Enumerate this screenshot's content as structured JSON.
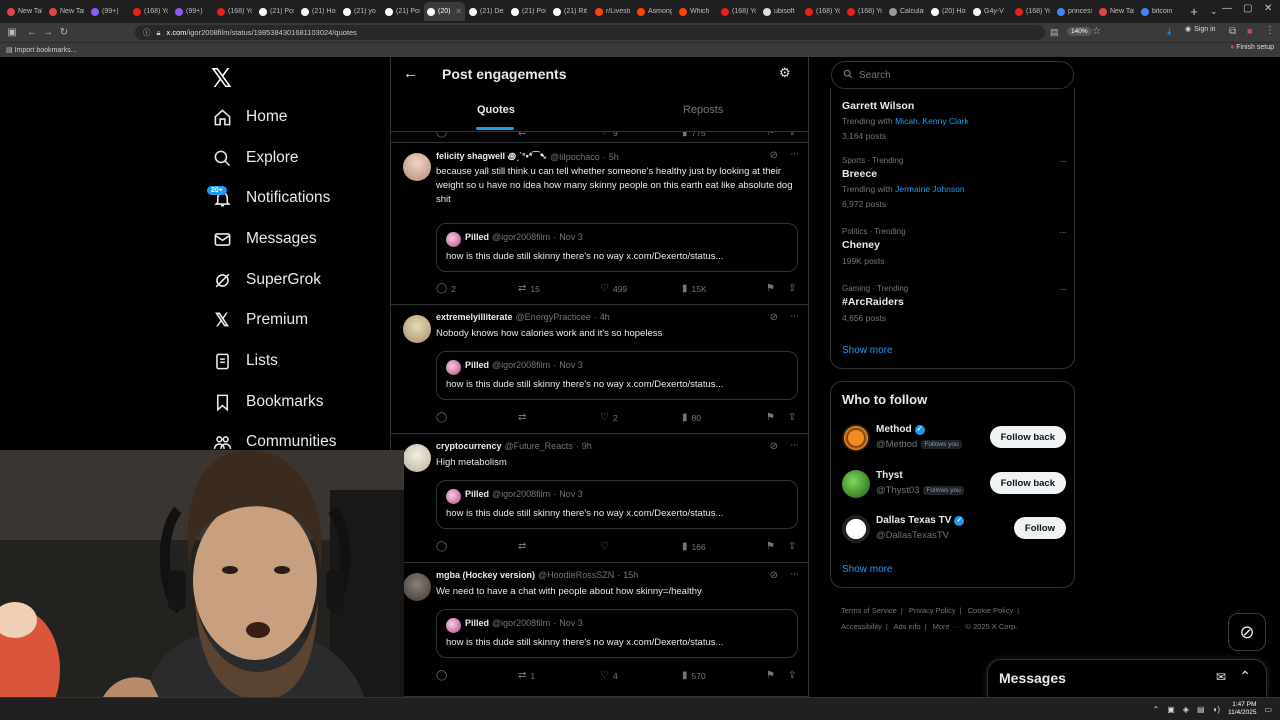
{
  "browser": {
    "tabs": [
      {
        "label": "New Tab",
        "color": "#e04545"
      },
      {
        "label": "New Tab",
        "color": "#e04545"
      },
      {
        "label": "(99+)",
        "color": "#8a5cf5"
      },
      {
        "label": "(168) YouTube",
        "color": "#e62117"
      },
      {
        "label": "(99+)",
        "color": "#8a5cf5"
      },
      {
        "label": "(168) YouTube",
        "color": "#e62117"
      },
      {
        "label": "(21) Post",
        "color": "#ffffff"
      },
      {
        "label": "(21) Home",
        "color": "#ffffff"
      },
      {
        "label": "(21) yo",
        "color": "#ffffff"
      },
      {
        "label": "(21) Post",
        "color": "#ffffff"
      },
      {
        "label": "(20)",
        "color": "#ffffff",
        "active": true
      },
      {
        "label": "(21) Dexerto",
        "color": "#ffffff"
      },
      {
        "label": "(21) Post",
        "color": "#ffffff"
      },
      {
        "label": "(21) Rit",
        "color": "#ffffff"
      },
      {
        "label": "r/Livestream",
        "color": "#ff4500"
      },
      {
        "label": "Asmongold",
        "color": "#ff4500"
      },
      {
        "label": "Which",
        "color": "#ff4500"
      },
      {
        "label": "(168) YouTube",
        "color": "#e62117"
      },
      {
        "label": "ubisoft",
        "color": "#dddddd"
      },
      {
        "label": "(168) YouTube",
        "color": "#e62117"
      },
      {
        "label": "(168) YouTube",
        "color": "#e62117"
      },
      {
        "label": "Calculator",
        "color": "#999999"
      },
      {
        "label": "(20) Home",
        "color": "#ffffff"
      },
      {
        "label": "G4y-V",
        "color": "#ffffff"
      },
      {
        "label": "(168) YouTube",
        "color": "#e62117"
      },
      {
        "label": "princess",
        "color": "#4285f4"
      },
      {
        "label": "New Tab",
        "color": "#e04545"
      },
      {
        "label": "bitcoin",
        "color": "#4285f4"
      }
    ],
    "url_host": "x.com",
    "url_path": "/igor2008film/status/1985384301681103024/quotes",
    "zoom": "140%",
    "signin": "Sign in",
    "import_bookmarks": "Import bookmarks...",
    "finish_setup": "Finish setup"
  },
  "nav": {
    "logo": "𝕏",
    "items": [
      {
        "label": "Home"
      },
      {
        "label": "Explore"
      },
      {
        "label": "Notifications"
      },
      {
        "label": "Messages"
      },
      {
        "label": "SuperGrok"
      },
      {
        "label": "Premium"
      },
      {
        "label": "Lists"
      },
      {
        "label": "Bookmarks"
      },
      {
        "label": "Communities"
      }
    ],
    "notif_count": "20+"
  },
  "header": {
    "back": "←",
    "title": "Post engagements",
    "tabs": [
      "Quotes",
      "Reposts"
    ]
  },
  "top_actions": {
    "likes": "9",
    "views": "775"
  },
  "quoted": {
    "name": "Pilled",
    "handle": "@igor2008film",
    "date": "Nov 3",
    "text": "how is this dude still skinny there's no way x.com/Dexerto/status..."
  },
  "tweets": [
    {
      "name": "felicity shagwell ꩜ˏˋ°•*⁀➷",
      "handle": "@liIpochaco",
      "time": "5h",
      "text": "because yall still think u can tell whether someone's healthy just by looking at their weight so u have no idea how many skinny people on this earth eat like absolute dog shit",
      "replies": "2",
      "reposts": "15",
      "likes": "499",
      "views": "15K"
    },
    {
      "name": "extremelyilliterate",
      "handle": "@EnergyPracticee",
      "time": "4h",
      "text": "Nobody knows how calories work and it's so hopeless",
      "replies": "",
      "reposts": "",
      "likes": "2",
      "views": "80"
    },
    {
      "name": "cryptocurrency",
      "handle": "@Future_Reacts",
      "time": "9h",
      "text": "High metabolism",
      "replies": "",
      "reposts": "",
      "likes": "",
      "views": "166"
    },
    {
      "name": "mgba (Hockey version)",
      "handle": "@HoodieRossSZN",
      "time": "15h",
      "text": "We need to have a chat with people about how skinny=/healthy",
      "replies": "",
      "reposts": "1",
      "likes": "4",
      "views": "570"
    }
  ],
  "search": {
    "placeholder": "Search"
  },
  "trends": [
    {
      "category": "",
      "title": "Garrett Wilson",
      "with_label": "Trending with",
      "with_names": "Micah, Kenny Clark",
      "posts": "3,164 posts"
    },
    {
      "category": "Sports · Trending",
      "title": "Breece",
      "with_label": "Trending with",
      "with_names": "Jermaine Johnson",
      "posts": "6,972 posts"
    },
    {
      "category": "Politics · Trending",
      "title": "Cheney",
      "with_label": "",
      "with_names": "",
      "posts": "199K posts"
    },
    {
      "category": "Gaming · Trending",
      "title": "#ArcRaiders",
      "with_label": "",
      "with_names": "",
      "posts": "4,656 posts"
    }
  ],
  "show_more": "Show more",
  "who_to_follow": {
    "title": "Who to follow",
    "accounts": [
      {
        "name": "Method",
        "handle": "@Method",
        "follows_you": "Follows you",
        "button": "Follow back",
        "verified": true
      },
      {
        "name": "Thyst",
        "handle": "@Thyst03",
        "follows_you": "Follows you",
        "button": "Follow back",
        "verified": false
      },
      {
        "name": "Dallas Texas TV",
        "handle": "@DallasTexasTV",
        "follows_you": "",
        "button": "Follow",
        "verified": true
      }
    ]
  },
  "footer": {
    "links": [
      "Terms of Service",
      "|",
      "Privacy Policy",
      "|",
      "Cookie Policy",
      "|",
      "Accessibility",
      "|",
      "Ads info",
      "|",
      "More ···",
      "© 2025 X Corp."
    ]
  },
  "messages_dock": {
    "title": "Messages"
  },
  "taskbar": {
    "time": "1:47 PM",
    "date": "11/4/2025"
  },
  "colors": {
    "accent": "#1d9bf0",
    "background": "#000000",
    "border": "#2f3336",
    "muted": "#71767b"
  }
}
